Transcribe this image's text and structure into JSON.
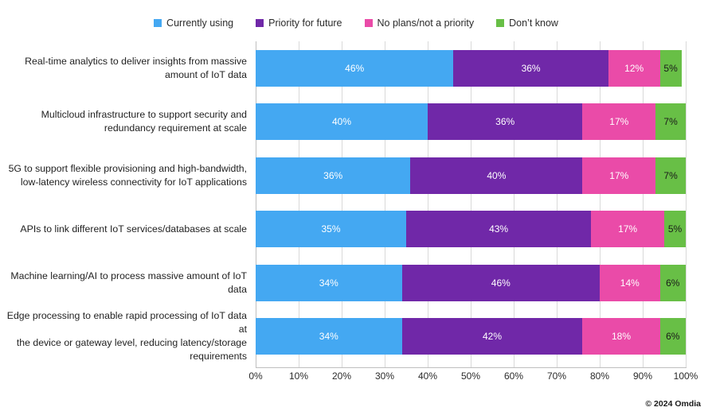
{
  "legend": {
    "position": "top-center",
    "items": [
      {
        "label": "Currently using",
        "color": "#44a8f2",
        "swatch_name": "legend-swatch-currently-using"
      },
      {
        "label": "Priority for future",
        "color": "#7028a8",
        "swatch_name": "legend-swatch-priority-for-future"
      },
      {
        "label": "No plans/not a priority",
        "color": "#ea4ba8",
        "swatch_name": "legend-swatch-no-plans"
      },
      {
        "label": "Don’t know",
        "color": "#68bf46",
        "swatch_name": "legend-swatch-dont-know"
      }
    ]
  },
  "footer": {
    "credit": "© 2024 Omdia"
  },
  "xticks": [
    {
      "label": "0%",
      "value": 0
    },
    {
      "label": "10%",
      "value": 10
    },
    {
      "label": "20%",
      "value": 20
    },
    {
      "label": "30%",
      "value": 30
    },
    {
      "label": "40%",
      "value": 40
    },
    {
      "label": "50%",
      "value": 50
    },
    {
      "label": "60%",
      "value": 60
    },
    {
      "label": "70%",
      "value": 70
    },
    {
      "label": "80%",
      "value": 80
    },
    {
      "label": "90%",
      "value": 90
    },
    {
      "label": "100%",
      "value": 100
    }
  ],
  "chart_data": {
    "type": "bar",
    "orientation": "horizontal",
    "stacked": true,
    "stack_total": 100,
    "title": "",
    "subtitle": "",
    "xlabel": "",
    "ylabel": "",
    "xlim": [
      0,
      100
    ],
    "xtick_step": 10,
    "grid": "vertical",
    "legend_position": "top-center",
    "value_label_suffix": "%",
    "categories": [
      "Real-time analytics to deliver insights from massive amount of IoT data",
      "Multicloud infrastructure to support security and redundancy requirement at scale",
      "5G to support flexible provisioning and high-bandwidth, low-latency wireless connectivity for IoT applications",
      "APIs to link different IoT services/databases at scale",
      "Machine learning/AI to process massive amount of IoT data",
      "Edge processing to enable rapid processing of IoT data at the device or gateway level, reducing latency/storage requirements"
    ],
    "series": [
      {
        "name": "Currently using",
        "color": "#44a8f2",
        "values": [
          46,
          40,
          36,
          35,
          34,
          34
        ]
      },
      {
        "name": "Priority for future",
        "color": "#7028a8",
        "values": [
          36,
          36,
          40,
          43,
          46,
          42
        ]
      },
      {
        "name": "No plans/not a priority",
        "color": "#ea4ba8",
        "values": [
          12,
          17,
          17,
          17,
          14,
          18
        ]
      },
      {
        "name": "Don’t know",
        "color": "#68bf46",
        "values": [
          5,
          7,
          7,
          5,
          6,
          6
        ]
      }
    ],
    "rows": [
      {
        "label": "Real-time analytics to deliver insights from massive amount of IoT data",
        "label_lines": [
          "Real-time analytics to deliver insights from massive",
          "amount of IoT data"
        ],
        "segments": [
          {
            "series": "Currently using",
            "value": 46,
            "label": "46%",
            "color": "#44a8f2",
            "text_color": "light"
          },
          {
            "series": "Priority for future",
            "value": 36,
            "label": "36%",
            "color": "#7028a8",
            "text_color": "light"
          },
          {
            "series": "No plans/not a priority",
            "value": 12,
            "label": "12%",
            "color": "#ea4ba8",
            "text_color": "light"
          },
          {
            "series": "Don’t know",
            "value": 5,
            "label": "5%",
            "color": "#68bf46",
            "text_color": "dark"
          }
        ]
      },
      {
        "label": "Multicloud infrastructure to support security and redundancy requirement at scale",
        "label_lines": [
          "Multicloud infrastructure to support security and",
          "redundancy requirement at scale"
        ],
        "segments": [
          {
            "series": "Currently using",
            "value": 40,
            "label": "40%",
            "color": "#44a8f2",
            "text_color": "light"
          },
          {
            "series": "Priority for future",
            "value": 36,
            "label": "36%",
            "color": "#7028a8",
            "text_color": "light"
          },
          {
            "series": "No plans/not a priority",
            "value": 17,
            "label": "17%",
            "color": "#ea4ba8",
            "text_color": "light"
          },
          {
            "series": "Don’t know",
            "value": 7,
            "label": "7%",
            "color": "#68bf46",
            "text_color": "dark"
          }
        ]
      },
      {
        "label": "5G to support flexible provisioning and high-bandwidth, low-latency wireless connectivity for IoT applications",
        "label_lines": [
          "5G to support flexible provisioning and high-bandwidth,",
          "low-latency wireless connectivity for IoT applications"
        ],
        "segments": [
          {
            "series": "Currently using",
            "value": 36,
            "label": "36%",
            "color": "#44a8f2",
            "text_color": "light"
          },
          {
            "series": "Priority for future",
            "value": 40,
            "label": "40%",
            "color": "#7028a8",
            "text_color": "light"
          },
          {
            "series": "No plans/not a priority",
            "value": 17,
            "label": "17%",
            "color": "#ea4ba8",
            "text_color": "light"
          },
          {
            "series": "Don’t know",
            "value": 7,
            "label": "7%",
            "color": "#68bf46",
            "text_color": "dark"
          }
        ]
      },
      {
        "label": "APIs to link different IoT services/databases at scale",
        "label_lines": [
          "APIs to link different IoT services/databases at scale"
        ],
        "segments": [
          {
            "series": "Currently using",
            "value": 35,
            "label": "35%",
            "color": "#44a8f2",
            "text_color": "light"
          },
          {
            "series": "Priority for future",
            "value": 43,
            "label": "43%",
            "color": "#7028a8",
            "text_color": "light"
          },
          {
            "series": "No plans/not a priority",
            "value": 17,
            "label": "17%",
            "color": "#ea4ba8",
            "text_color": "light"
          },
          {
            "series": "Don’t know",
            "value": 5,
            "label": "5%",
            "color": "#68bf46",
            "text_color": "dark"
          }
        ]
      },
      {
        "label": "Machine learning/AI to process massive amount of IoT data",
        "label_lines": [
          "Machine learning/AI to process massive amount of IoT",
          "data"
        ],
        "segments": [
          {
            "series": "Currently using",
            "value": 34,
            "label": "34%",
            "color": "#44a8f2",
            "text_color": "light"
          },
          {
            "series": "Priority for future",
            "value": 46,
            "label": "46%",
            "color": "#7028a8",
            "text_color": "light"
          },
          {
            "series": "No plans/not a priority",
            "value": 14,
            "label": "14%",
            "color": "#ea4ba8",
            "text_color": "light"
          },
          {
            "series": "Don’t know",
            "value": 6,
            "label": "6%",
            "color": "#68bf46",
            "text_color": "dark"
          }
        ]
      },
      {
        "label": "Edge processing to enable rapid processing of IoT data at the device or gateway level, reducing latency/storage requirements",
        "label_lines": [
          "Edge processing to enable rapid processing of IoT data at",
          "the device or gateway level, reducing latency/storage",
          "requirements"
        ],
        "segments": [
          {
            "series": "Currently using",
            "value": 34,
            "label": "34%",
            "color": "#44a8f2",
            "text_color": "light"
          },
          {
            "series": "Priority for future",
            "value": 42,
            "label": "42%",
            "color": "#7028a8",
            "text_color": "light"
          },
          {
            "series": "No plans/not a priority",
            "value": 18,
            "label": "18%",
            "color": "#ea4ba8",
            "text_color": "light"
          },
          {
            "series": "Don’t know",
            "value": 6,
            "label": "6%",
            "color": "#68bf46",
            "text_color": "dark"
          }
        ]
      }
    ]
  }
}
